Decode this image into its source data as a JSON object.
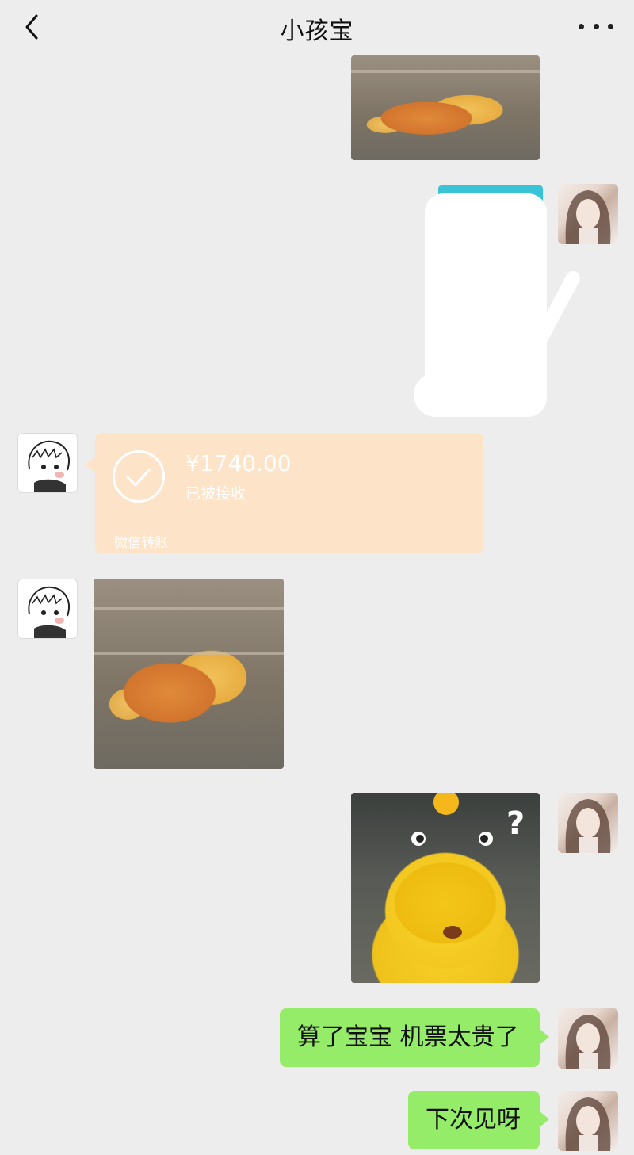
{
  "header": {
    "title": "小孩宝",
    "back_icon": "chevron-left-icon",
    "more_icon": "more-horizontal-icon"
  },
  "messages": [
    {
      "side": "right",
      "type": "image",
      "depicts": "sweet-potato-sticker"
    },
    {
      "side": "right",
      "type": "image",
      "depicts": "redacted-image"
    },
    {
      "side": "left",
      "type": "transfer",
      "amount": "¥1740.00",
      "status": "已被接收",
      "label": "微信转账"
    },
    {
      "side": "left",
      "type": "image",
      "depicts": "sweet-potato-sticker"
    },
    {
      "side": "right",
      "type": "image",
      "depicts": "yellow-duck-question-sticker"
    },
    {
      "side": "right",
      "type": "text",
      "text": "算了宝宝 机票太贵了"
    },
    {
      "side": "right",
      "type": "text",
      "text": "下次见呀"
    }
  ],
  "colors": {
    "background": "#ededed",
    "sent_bubble": "#95ec69",
    "transfer_card": "#fde3c7"
  }
}
